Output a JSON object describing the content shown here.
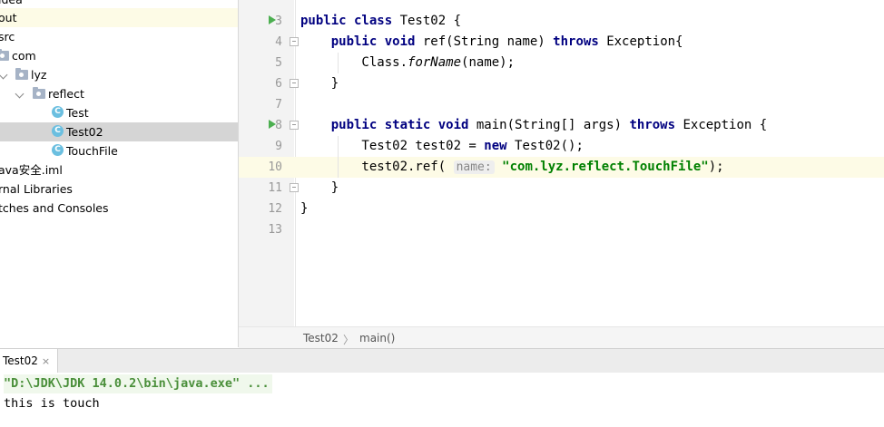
{
  "sidebar": {
    "items": [
      {
        "label": "idea"
      },
      {
        "label": "out"
      },
      {
        "label": "src"
      },
      {
        "label": "com"
      },
      {
        "label": "lyz"
      },
      {
        "label": "reflect"
      },
      {
        "label": "Test",
        "icon": "C"
      },
      {
        "label": "Test02",
        "icon": "C"
      },
      {
        "label": "TouchFile",
        "icon": "C"
      },
      {
        "label": "ava安全.iml"
      },
      {
        "label": "rnal Libraries"
      },
      {
        "label": "tches and Consoles"
      }
    ]
  },
  "editor": {
    "line_numbers": [
      "3",
      "4",
      "5",
      "6",
      "7",
      "8",
      "9",
      "10",
      "11",
      "12",
      "13"
    ],
    "lines": [
      [
        {
          "t": "public class ",
          "c": "kw"
        },
        {
          "t": "Test02 {"
        }
      ],
      [
        {
          "t": "    "
        },
        {
          "t": "public void ",
          "c": "kw"
        },
        {
          "t": "ref(String name) "
        },
        {
          "t": "throws ",
          "c": "kw"
        },
        {
          "t": "Exception{"
        }
      ],
      [
        {
          "t": "        Class."
        },
        {
          "t": "forName",
          "c": "it"
        },
        {
          "t": "(name);"
        }
      ],
      [
        {
          "t": "    }"
        }
      ],
      [
        {
          "t": ""
        }
      ],
      [
        {
          "t": "    "
        },
        {
          "t": "public static void ",
          "c": "kw"
        },
        {
          "t": "main(String[] args) "
        },
        {
          "t": "throws ",
          "c": "kw"
        },
        {
          "t": "Exception {"
        }
      ],
      [
        {
          "t": "        Test02 test02 = "
        },
        {
          "t": "new ",
          "c": "kw"
        },
        {
          "t": "Test02();"
        }
      ],
      [
        {
          "t": "        test02.ref( "
        },
        {
          "t": "name:",
          "c": "hint"
        },
        {
          "t": " "
        },
        {
          "t": "\"com.lyz.reflect.TouchFile\"",
          "c": "str"
        },
        {
          "t": ");"
        }
      ],
      [
        {
          "t": "    }"
        }
      ],
      [
        {
          "t": "}"
        }
      ],
      [
        {
          "t": ""
        }
      ]
    ]
  },
  "breadcrumb": {
    "class": "Test02",
    "sep": "〉",
    "method": "main()"
  },
  "run_panel": {
    "tab_label": "Test02",
    "close": "×",
    "command": "\"D:\\JDK\\JDK 14.0.2\\bin\\java.exe\" ...",
    "output": "this is touch"
  },
  "colors": {
    "keyword": "#000080",
    "string": "#008000",
    "current_line": "#fdfbe6",
    "run_icon": "#4caf50"
  },
  "icons": [
    "run-gutter-icon",
    "fold-icon",
    "folder-icon",
    "package-icon",
    "class-icon",
    "close-icon"
  ]
}
